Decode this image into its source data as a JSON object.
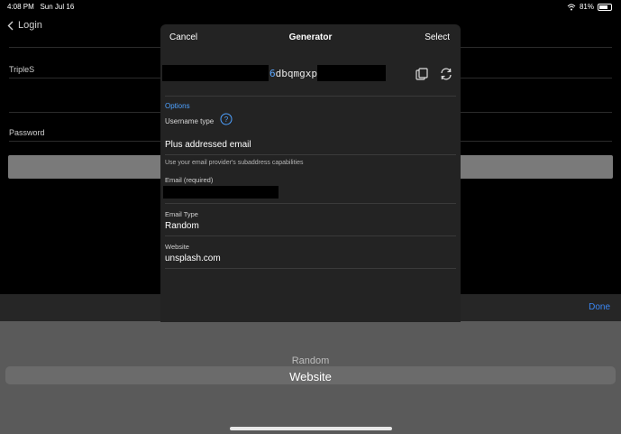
{
  "status": {
    "time": "4:08 PM",
    "date": "Sun Jul 16",
    "battery": "81%"
  },
  "background": {
    "back_label": "Login",
    "fields": [
      {
        "label": "TripleS"
      },
      {
        "label": "Password"
      }
    ],
    "done_label": "Done"
  },
  "picker": {
    "options": [
      "Random",
      "Website"
    ],
    "selected": "Website"
  },
  "modal": {
    "cancel_label": "Cancel",
    "title": "Generator",
    "select_label": "Select",
    "generated_visible": "6dbqmgxp",
    "options_label": "Options",
    "username_type_label": "Username type",
    "username_type_value": "Plus addressed email",
    "hint": "Use your email provider's subaddress capabilities",
    "email_label": "Email (required)",
    "email_type_label": "Email Type",
    "email_type_value": "Random",
    "website_label": "Website",
    "website_value": "unsplash.com"
  },
  "colors": {
    "accent": "#4ea1ff",
    "done": "#3b87f5",
    "modal_bg": "#232323"
  }
}
